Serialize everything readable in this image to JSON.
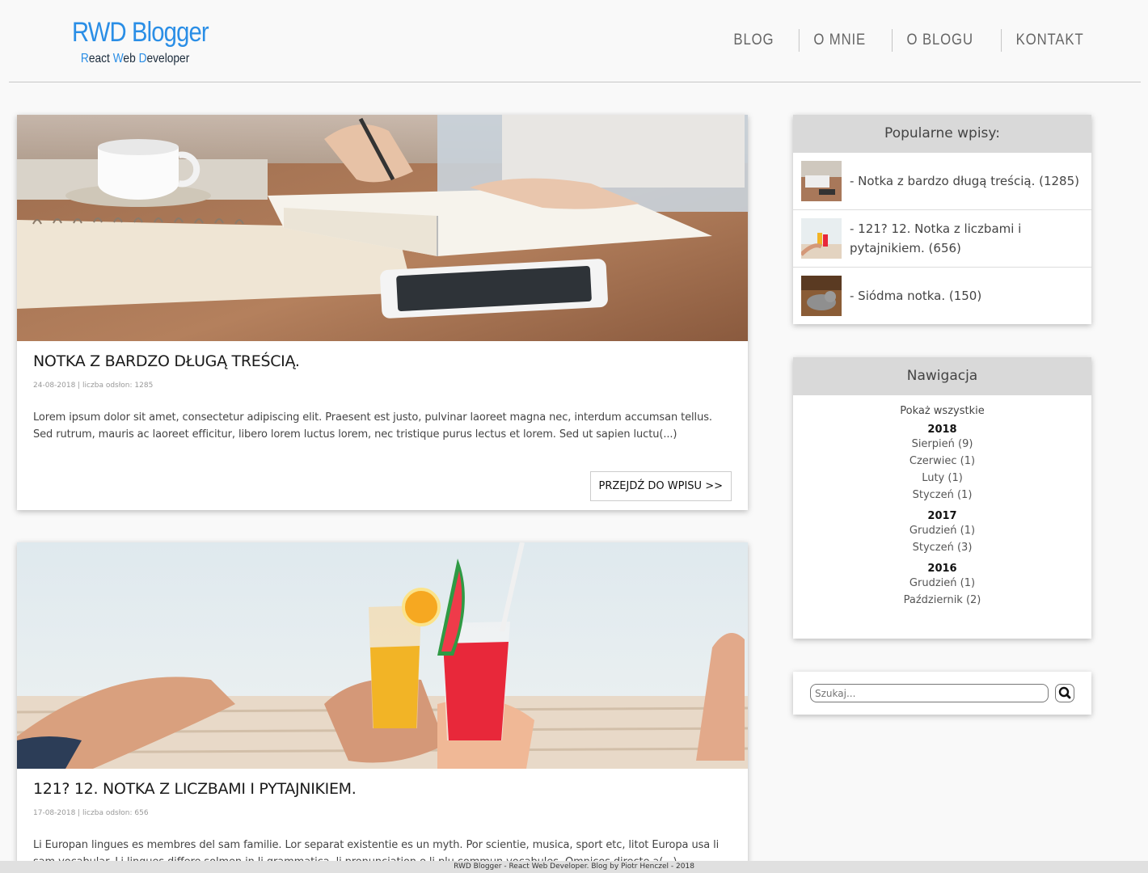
{
  "header": {
    "logo_title": "RWD Blogger",
    "logo_sub_r": "R",
    "logo_sub_1": "eact ",
    "logo_sub_w": "W",
    "logo_sub_2": "eb ",
    "logo_sub_d": "D",
    "logo_sub_3": "eveloper",
    "nav": [
      "BLOG",
      "O MNIE",
      "O BLOGU",
      "KONTAKT"
    ]
  },
  "posts": [
    {
      "title": "NOTKA Z BARDZO DŁUGĄ TREŚCIĄ.",
      "meta": "24-08-2018 | liczba odsłon: 1285",
      "excerpt": "Lorem ipsum dolor sit amet, consectetur adipiscing elit. Praesent est justo, pulvinar laoreet magna nec, interdum accumsan tellus. Sed rutrum, mauris ac laoreet efficitur, libero lorem luctus lorem, nec tristique purus lectus et lorem. Sed ut sapien luctu(...)",
      "button": "PRZEJDŹ DO WPISU >>"
    },
    {
      "title": "121? 12. NOTKA Z LICZBAMI I PYTAJNIKIEM.",
      "meta": "17-08-2018 | liczba odsłon: 656",
      "excerpt": "Li Europan lingues es membres del sam familie. Lor separat existentie es un myth. Por scientie, musica, sport etc, litot Europa usa li sam vocabular. Li lingues differe solmen in li grammatica, li pronunciation e li plu commun vocabules. Omnicos directe a(...)"
    }
  ],
  "popular": {
    "heading": "Popularne wpisy:",
    "items": [
      {
        "text": "- Notka z bardzo długą treścią. (1285)"
      },
      {
        "text": "- 121? 12. Notka z liczbami i pytajnikiem. (656)"
      },
      {
        "text": "- Siódma notka. (150)"
      }
    ]
  },
  "navigation": {
    "heading": "Nawigacja",
    "all": "Pokaż wszystkie",
    "years": [
      {
        "year": "2018",
        "months": [
          "Sierpień (9)",
          "Czerwiec (1)",
          "Luty (1)",
          "Styczeń (1)"
        ]
      },
      {
        "year": "2017",
        "months": [
          "Grudzień (1)",
          "Styczeń (3)"
        ]
      },
      {
        "year": "2016",
        "months": [
          "Grudzień (1)",
          "Październik (2)"
        ]
      }
    ]
  },
  "search": {
    "placeholder": "Szukaj..."
  },
  "footer": {
    "text": "RWD Blogger - React Web Developer. Blog by Piotr Henczel - 2018"
  }
}
